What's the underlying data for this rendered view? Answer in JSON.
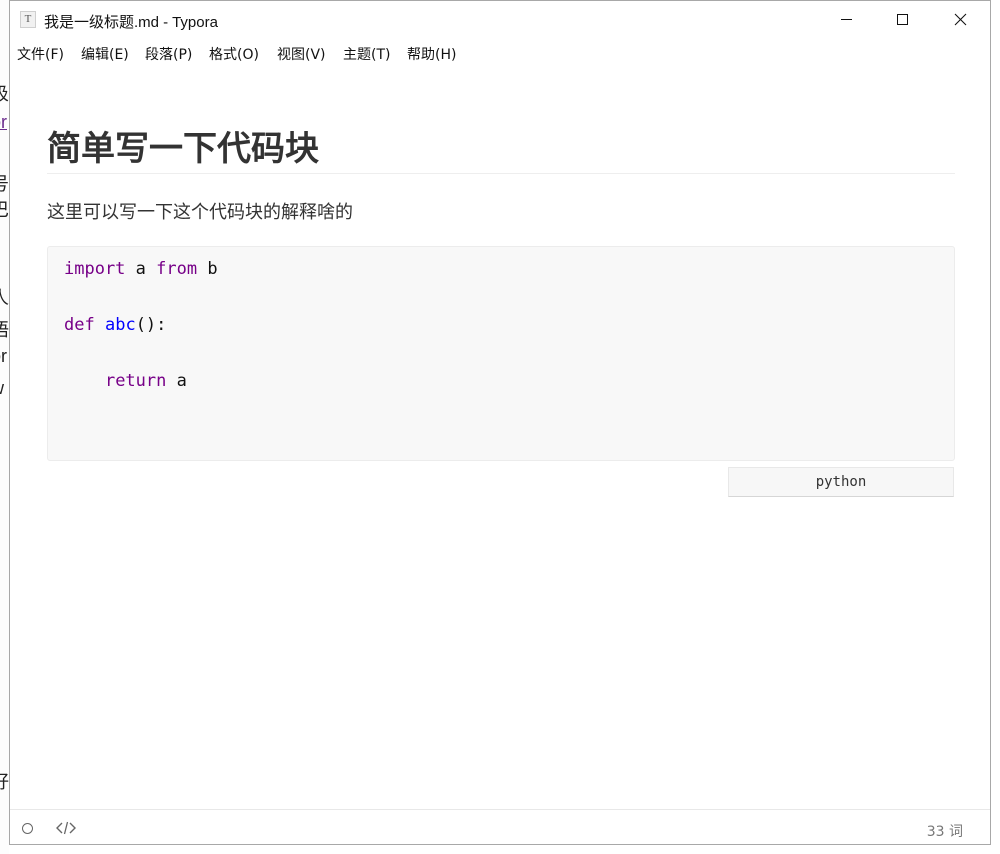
{
  "window": {
    "title": "我是一级标题.md - Typora",
    "app_icon_letter": "T"
  },
  "menu": {
    "items": [
      {
        "label": "文件(F)"
      },
      {
        "label": "编辑(E)"
      },
      {
        "label": "段落(P)"
      },
      {
        "label": "格式(O)"
      },
      {
        "label": "视图(V)"
      },
      {
        "label": "主题(T)"
      },
      {
        "label": "帮助(H)"
      }
    ]
  },
  "document": {
    "heading": "简单写一下代码块",
    "paragraph": "这里可以写一下这个代码块的解释啥的",
    "code": {
      "language": "python",
      "line1": {
        "kw1": "import",
        "t1": " a ",
        "kw2": "from",
        "t2": " b"
      },
      "line2": {
        "kw": "def",
        "sp": " ",
        "fn": "abc",
        "rest": "():"
      },
      "line3": {
        "indent": "    ",
        "kw": "return",
        "rest": " a"
      }
    }
  },
  "statusbar": {
    "word_count": "33 词"
  },
  "background_window": {
    "fragments": [
      "汲",
      "or",
      "号",
      "巴",
      "人",
      "语",
      "or",
      "w",
      "好"
    ]
  },
  "colors": {
    "keyword": "#770088",
    "function_name": "#0000ff",
    "code_background": "#f8f8f8",
    "text": "#333333"
  }
}
